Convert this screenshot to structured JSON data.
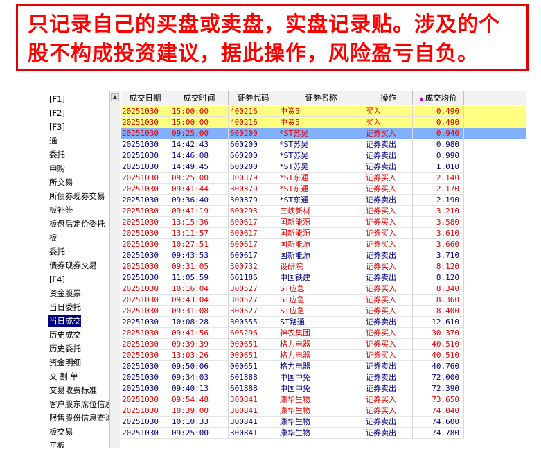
{
  "banner": {
    "line1": "只记录自己的买盘或卖盘，实盘记录贴。涉及的个",
    "line2": "股不构成投资建议，据此操作，风险盈亏自负。"
  },
  "colors": {
    "buy": "#e00000",
    "sell": "#000080",
    "highlight": "#ffff80",
    "selected": "#80b0ff"
  },
  "tree": {
    "items": [
      "[F1]",
      "[F2]",
      "[F3]",
      "通",
      "委托",
      "申购",
      "所交易",
      "所债券现券交易",
      "板补签",
      "板盘后定价委托",
      "板",
      "委托",
      "债券现券交易",
      "[F4]",
      "资金股票",
      "当日委托",
      "当日成交",
      "历史成交",
      "历史委托",
      "资金明细",
      "交 割 单",
      "交易收费标准",
      "客户股东席位信息",
      "限售股份信息查询",
      "板交易",
      "平板"
    ],
    "selected_index": 16
  },
  "table": {
    "headers": [
      "成交日期",
      "成交时间",
      "证券代码",
      "证券名称",
      "操作",
      "成交均价"
    ],
    "sorted_col": 5,
    "rows": [
      {
        "date": "20251030",
        "time": "15:00:00",
        "code": "400216",
        "name": "中资5",
        "op": "买入",
        "price": "0.490",
        "side": "buy",
        "hl": "highlight"
      },
      {
        "date": "20251030",
        "time": "15:00:00",
        "code": "400216",
        "name": "中资5",
        "op": "买入",
        "price": "0.490",
        "side": "buy",
        "hl": "highlight"
      },
      {
        "date": "20251030",
        "time": "09:25:00",
        "code": "600200",
        "name": "*ST苏吴",
        "op": "证券买入",
        "price": "0.940",
        "side": "buy",
        "hl": "selected"
      },
      {
        "date": "20251030",
        "time": "14:42:43",
        "code": "600200",
        "name": "*ST苏吴",
        "op": "证券卖出",
        "price": "0.980",
        "side": "sell",
        "hl": ""
      },
      {
        "date": "20251030",
        "time": "14:46:08",
        "code": "600200",
        "name": "*ST苏吴",
        "op": "证券卖出",
        "price": "0.990",
        "side": "sell",
        "hl": ""
      },
      {
        "date": "20251030",
        "time": "14:49:45",
        "code": "600200",
        "name": "*ST苏吴",
        "op": "证券卖出",
        "price": "1.010",
        "side": "sell",
        "hl": ""
      },
      {
        "date": "20251030",
        "time": "09:25:00",
        "code": "300379",
        "name": "*ST东通",
        "op": "证券买入",
        "price": "2.140",
        "side": "buy",
        "hl": ""
      },
      {
        "date": "20251030",
        "time": "09:41:44",
        "code": "300379",
        "name": "*ST东通",
        "op": "证券买入",
        "price": "2.170",
        "side": "buy",
        "hl": ""
      },
      {
        "date": "20251030",
        "time": "09:36:40",
        "code": "300379",
        "name": "*ST东通",
        "op": "证券卖出",
        "price": "2.190",
        "side": "sell",
        "hl": ""
      },
      {
        "date": "20251030",
        "time": "09:41:19",
        "code": "600293",
        "name": "三峡新材",
        "op": "证券买入",
        "price": "3.210",
        "side": "buy",
        "hl": ""
      },
      {
        "date": "20251030",
        "time": "13:15:36",
        "code": "600617",
        "name": "国新能源",
        "op": "证券买入",
        "price": "3.580",
        "side": "buy",
        "hl": ""
      },
      {
        "date": "20251030",
        "time": "13:11:57",
        "code": "600617",
        "name": "国新能源",
        "op": "证券买入",
        "price": "3.610",
        "side": "buy",
        "hl": ""
      },
      {
        "date": "20251030",
        "time": "10:27:51",
        "code": "600617",
        "name": "国新能源",
        "op": "证券买入",
        "price": "3.660",
        "side": "buy",
        "hl": ""
      },
      {
        "date": "20251030",
        "time": "09:43:53",
        "code": "600617",
        "name": "国新能源",
        "op": "证券卖出",
        "price": "3.710",
        "side": "sell",
        "hl": ""
      },
      {
        "date": "20251030",
        "time": "09:31:05",
        "code": "300732",
        "name": "设研院",
        "op": "证券买入",
        "price": "8.120",
        "side": "buy",
        "hl": ""
      },
      {
        "date": "20251030",
        "time": "11:05:59",
        "code": "601186",
        "name": "中国铁建",
        "op": "证券卖出",
        "price": "8.120",
        "side": "sell",
        "hl": ""
      },
      {
        "date": "20251030",
        "time": "10:16:04",
        "code": "300527",
        "name": "ST应急",
        "op": "证券买入",
        "price": "8.340",
        "side": "buy",
        "hl": ""
      },
      {
        "date": "20251030",
        "time": "09:43:04",
        "code": "300527",
        "name": "ST应急",
        "op": "证券买入",
        "price": "8.360",
        "side": "buy",
        "hl": ""
      },
      {
        "date": "20251030",
        "time": "09:31:08",
        "code": "300527",
        "name": "ST应急",
        "op": "证券买入",
        "price": "8.400",
        "side": "buy",
        "hl": ""
      },
      {
        "date": "20251030",
        "time": "10:08:28",
        "code": "300555",
        "name": "ST路通",
        "op": "证券卖出",
        "price": "12.610",
        "side": "sell",
        "hl": ""
      },
      {
        "date": "20251030",
        "time": "09:41:56",
        "code": "605296",
        "name": "神农集团",
        "op": "证券买入",
        "price": "30.370",
        "side": "buy",
        "hl": ""
      },
      {
        "date": "20251030",
        "time": "09:39:39",
        "code": "000651",
        "name": "格力电器",
        "op": "证券买入",
        "price": "40.510",
        "side": "buy",
        "hl": ""
      },
      {
        "date": "20251030",
        "time": "13:03:26",
        "code": "000651",
        "name": "格力电器",
        "op": "证券买入",
        "price": "40.510",
        "side": "buy",
        "hl": ""
      },
      {
        "date": "20251030",
        "time": "09:50:06",
        "code": "000651",
        "name": "格力电器",
        "op": "证券卖出",
        "price": "40.760",
        "side": "sell",
        "hl": ""
      },
      {
        "date": "20251030",
        "time": "09:34:03",
        "code": "601888",
        "name": "中国中免",
        "op": "证券卖出",
        "price": "72.000",
        "side": "sell",
        "hl": ""
      },
      {
        "date": "20251030",
        "time": "09:40:13",
        "code": "601888",
        "name": "中国中免",
        "op": "证券卖出",
        "price": "72.390",
        "side": "sell",
        "hl": ""
      },
      {
        "date": "20251030",
        "time": "09:54:48",
        "code": "300841",
        "name": "康华生物",
        "op": "证券买入",
        "price": "73.650",
        "side": "buy",
        "hl": ""
      },
      {
        "date": "20251030",
        "time": "10:39:00",
        "code": "300841",
        "name": "康华生物",
        "op": "证券买入",
        "price": "74.040",
        "side": "buy",
        "hl": ""
      },
      {
        "date": "20251030",
        "time": "10:10:33",
        "code": "300841",
        "name": "康华生物",
        "op": "证券卖出",
        "price": "74.600",
        "side": "sell",
        "hl": ""
      },
      {
        "date": "20251030",
        "time": "09:25:00",
        "code": "300841",
        "name": "康华生物",
        "op": "证券卖出",
        "price": "74.780",
        "side": "sell",
        "hl": ""
      }
    ]
  }
}
